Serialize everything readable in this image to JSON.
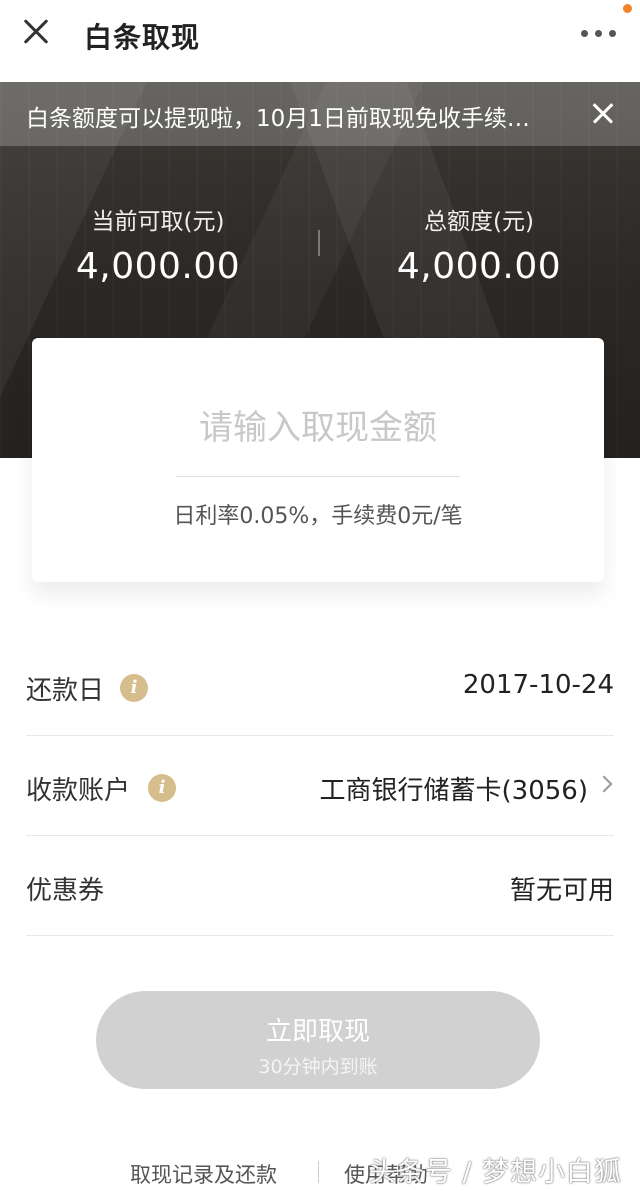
{
  "header": {
    "title": "白条取现",
    "close_icon": "close-icon",
    "more_icon": "more-icon",
    "badge_color": "#f0822a"
  },
  "notice": {
    "text": "白条额度可以提现啦，10月1日前取现免收手续…",
    "close_icon": "close-icon"
  },
  "stats": {
    "available_label": "当前可取(元)",
    "available_value": "4,000.00",
    "total_label": "总额度(元)",
    "total_value": "4,000.00"
  },
  "withdraw_card": {
    "amount_placeholder": "请输入取现金额",
    "amount_value": "",
    "rate_text": "日利率0.05%，手续费0元/笔"
  },
  "details": {
    "repay_label": "还款日",
    "repay_value": "2017-10-24",
    "account_label": "收款账户",
    "account_value": "工商银行储蓄卡(3056)",
    "coupon_label": "优惠券",
    "coupon_value": "暂无可用",
    "info_icon": "info-icon",
    "info_icon_color": "#d6bd8c"
  },
  "submit": {
    "label": "立即取现",
    "sub_label": "30分钟内到账"
  },
  "footer": {
    "records_link": "取现记录及还款",
    "help_link": "使用帮助"
  },
  "watermark": {
    "text": "头条号 / 梦想小白狐"
  }
}
